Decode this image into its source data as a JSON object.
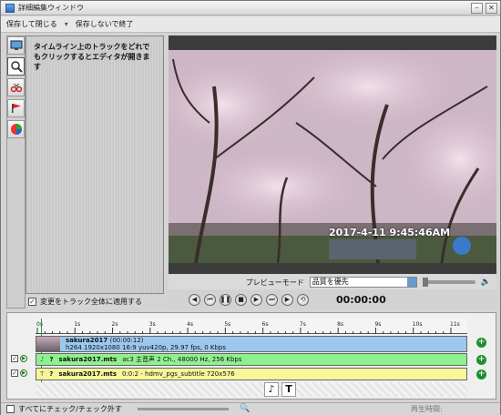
{
  "window": {
    "title": "詳細編集ウィンドウ"
  },
  "menu": {
    "save_close": "保存して閉じる",
    "close_nosave": "保存しないで終了"
  },
  "panel": {
    "hint": "タイムライン上のトラックをどれでもクリックするとエディタが開きます"
  },
  "apply_all": {
    "label": "変更をトラック全体に適用する",
    "checked": true
  },
  "preview": {
    "timestamp": "2017-4-11  9:45:46AM"
  },
  "mode": {
    "label": "プレビューモード",
    "value": "品質を優先"
  },
  "transport": {
    "timecode": "00:00:00"
  },
  "timeline": {
    "ticks": [
      "0s",
      "1s",
      "2s",
      "3s",
      "4s",
      "5s",
      "6s",
      "7s",
      "8s",
      "9s",
      "10s",
      "11s"
    ],
    "tracks": [
      {
        "title": "sakura2017",
        "duration": "(00:00:12)",
        "info": "h264 1920x1080 16:9 yuv420p, 29.97 fps, 0 Kbps",
        "color": "#9cc8ef"
      },
      {
        "title": "sakura2017.mts",
        "info": "ac3 主音声 2 Ch., 48000 Hz, 256 Kbps",
        "color": "#8ff08f"
      },
      {
        "title": "sakura2017.mts",
        "info": "0:0:2 - hdmv_pgs_subtitle 720x576",
        "color": "#f6f69a"
      }
    ],
    "marker": "?"
  },
  "status": {
    "toggle_all": "すべてにチェック/チェック外す",
    "play_time": "再生時間:"
  }
}
